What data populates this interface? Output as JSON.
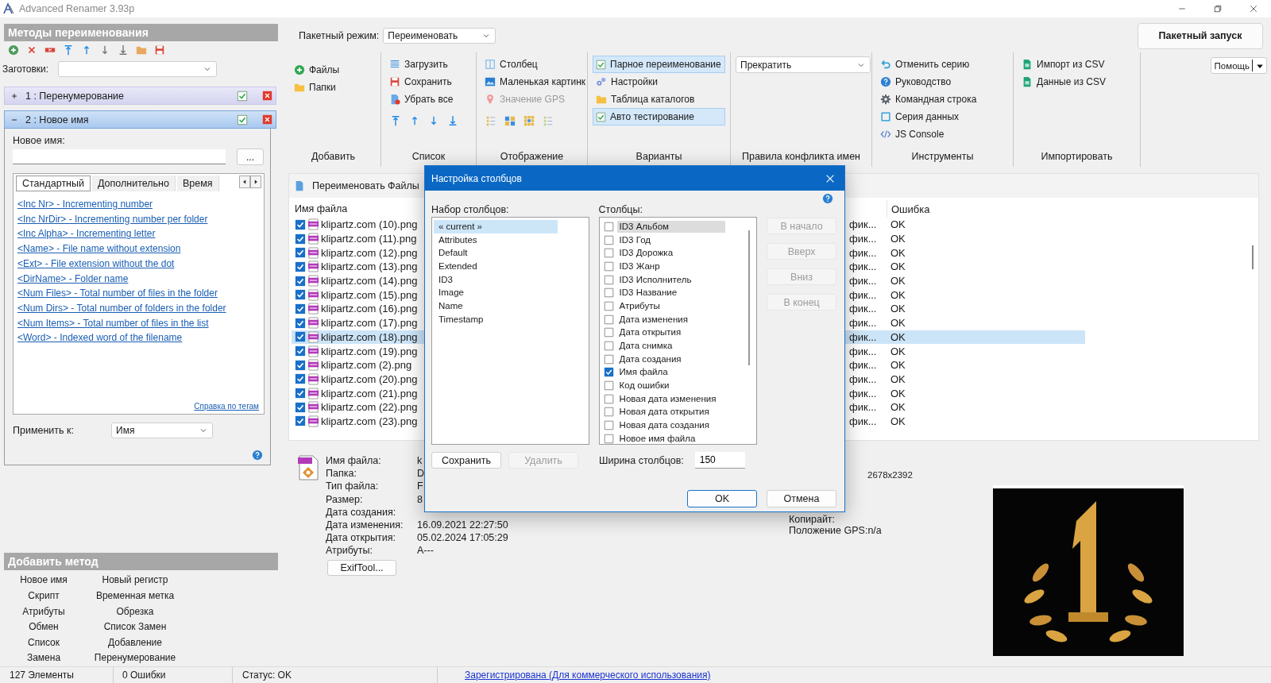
{
  "window": {
    "title": "Advanced Renamer 3.93p"
  },
  "methods_panel": {
    "title": "Методы переименования",
    "presets_label": "Заготовки:",
    "methods": [
      {
        "label": "1 : Перенумерование",
        "expanded": false,
        "enabled": true
      },
      {
        "label": "2 : Новое имя",
        "expanded": true,
        "enabled": true
      }
    ],
    "new_name_label": "Новое имя:",
    "browse_button": "...",
    "tabs": [
      {
        "label": "Стандартный",
        "selected": true
      },
      {
        "label": "Дополнительно",
        "selected": false
      },
      {
        "label": "Время",
        "selected": false
      }
    ],
    "tags": [
      "<Inc Nr> - Incrementing number",
      "<Inc NrDir> - Incrementing number per folder",
      "<Inc Alpha> - Incrementing letter",
      "<Name> - File name without extension",
      "<Ext> - File extension without the dot",
      "<DirName> - Folder name",
      "<Num Files> - Total number of files in the folder",
      "<Num Dirs> - Total number of folders in the folder",
      "<Num Items> - Total number of files in the list",
      "<Word> - Indexed word of the filename"
    ],
    "tag_help_link": "Справка по тегам",
    "apply_to_label": "Применить к:",
    "apply_to_value": "Имя"
  },
  "add_method": {
    "title": "Добавить метод",
    "items": [
      "Новое имя",
      "Новый регистр",
      "Скрипт",
      "Временная метка",
      "Атрибуты",
      "Обрезка",
      "Обмен",
      "Список Замен",
      "Список",
      "Добавление",
      "Замена",
      "Перенумерование"
    ]
  },
  "batch_mode": {
    "label": "Пакетный режим:",
    "value": "Переименовать"
  },
  "batch_start_button": "Пакетный запуск",
  "ribbon": {
    "groups": [
      {
        "title": "Добавить",
        "items": [
          {
            "kind": "command",
            "label": "Файлы"
          },
          {
            "kind": "command",
            "label": "Папки"
          }
        ]
      },
      {
        "title": "Список",
        "items": [
          {
            "kind": "command",
            "label": "Загрузить"
          },
          {
            "kind": "command",
            "label": "Сохранить"
          },
          {
            "kind": "command",
            "label": "Убрать все"
          }
        ]
      },
      {
        "title": "Отображение",
        "items": [
          {
            "kind": "command",
            "label": "Столбец",
            "disabled": false
          },
          {
            "kind": "command",
            "label": "Маленькая картинк",
            "disabled": false
          },
          {
            "kind": "command",
            "label": "Значение GPS",
            "disabled": true
          }
        ]
      },
      {
        "title": "Варианты",
        "items": [
          {
            "kind": "toggle",
            "label": "Парное переименование",
            "checked": true
          },
          {
            "kind": "command",
            "label": "Настройки"
          },
          {
            "kind": "command",
            "label": "Таблица каталогов"
          },
          {
            "kind": "toggle",
            "label": "Авто тестирование",
            "checked": true
          }
        ]
      },
      {
        "title": "Правила конфликта имен",
        "items": [
          {
            "kind": "dropdown",
            "label": "Прекратить"
          }
        ]
      },
      {
        "title": "Инструменты",
        "items": [
          {
            "kind": "command",
            "label": "Отменить серию"
          },
          {
            "kind": "command",
            "label": "Руководство"
          },
          {
            "kind": "command",
            "label": "Командная строка"
          },
          {
            "kind": "command",
            "label": "Серия данных"
          },
          {
            "kind": "command",
            "label": "JS Console"
          }
        ]
      },
      {
        "title": "Импортировать",
        "items": [
          {
            "kind": "command",
            "label": "Импорт из CSV"
          },
          {
            "kind": "command",
            "label": "Данные из CSV"
          }
        ]
      }
    ]
  },
  "help_button": "Помощь",
  "file_panel": {
    "title": "Переименовать Файлы",
    "columns": [
      "Имя файла",
      "Ошибка"
    ],
    "rows": [
      {
        "name": "klipartz.com (10).png",
        "column_2": "фик...",
        "error": "OK",
        "checked": true,
        "selected": false
      },
      {
        "name": "klipartz.com (11).png",
        "column_2": "фик...",
        "error": "OK",
        "checked": true,
        "selected": false
      },
      {
        "name": "klipartz.com (12).png",
        "column_2": "фик...",
        "error": "OK",
        "checked": true,
        "selected": false
      },
      {
        "name": "klipartz.com (13).png",
        "column_2": "фик...",
        "error": "OK",
        "checked": true,
        "selected": false
      },
      {
        "name": "klipartz.com (14).png",
        "column_2": "фик...",
        "error": "OK",
        "checked": true,
        "selected": false
      },
      {
        "name": "klipartz.com (15).png",
        "column_2": "фик...",
        "error": "OK",
        "checked": true,
        "selected": false
      },
      {
        "name": "klipartz.com (16).png",
        "column_2": "фик...",
        "error": "OK",
        "checked": true,
        "selected": false
      },
      {
        "name": "klipartz.com (17).png",
        "column_2": "фик...",
        "error": "OK",
        "checked": true,
        "selected": false
      },
      {
        "name": "klipartz.com (18).png",
        "column_2": "фик...",
        "error": "OK",
        "checked": true,
        "selected": true
      },
      {
        "name": "klipartz.com (19).png",
        "column_2": "фик...",
        "error": "OK",
        "checked": true,
        "selected": false
      },
      {
        "name": "klipartz.com (2).png",
        "column_2": "фик...",
        "error": "OK",
        "checked": true,
        "selected": false
      },
      {
        "name": "klipartz.com (20).png",
        "column_2": "фик...",
        "error": "OK",
        "checked": true,
        "selected": false
      },
      {
        "name": "klipartz.com (21).png",
        "column_2": "фик...",
        "error": "OK",
        "checked": true,
        "selected": false
      },
      {
        "name": "klipartz.com (22).png",
        "column_2": "фик...",
        "error": "OK",
        "checked": true,
        "selected": false
      },
      {
        "name": "klipartz.com (23).png",
        "column_2": "фик...",
        "error": "OK",
        "checked": true,
        "selected": false
      }
    ]
  },
  "file_info": {
    "fields": [
      {
        "label": "Имя файла:",
        "value": "k"
      },
      {
        "label": "Папка:",
        "value": "D"
      },
      {
        "label": "Тип файла:",
        "value": "F"
      },
      {
        "label": "Размер:",
        "value": "8"
      },
      {
        "label": "Дата создания:"
      },
      {
        "label": "Дата изменения:",
        "value": "16.09.2021 22:27:50"
      },
      {
        "label": "Дата открытия:",
        "value": "05.02.2024 17:05:29"
      },
      {
        "label": "Атрибуты:",
        "value": "A---"
      }
    ],
    "exif_button": "ExifTool...",
    "dimensions": "2678x2392",
    "copyright_label": "Копирайт:",
    "gps": "Положение GPS:n/a"
  },
  "dialog": {
    "title": "Настройка столбцов",
    "sets_label": "Набор столбцов:",
    "sets": [
      {
        "label": "« current »",
        "selected": true
      },
      {
        "label": "Attributes",
        "selected": false
      },
      {
        "label": "Default",
        "selected": false
      },
      {
        "label": "Extended",
        "selected": false
      },
      {
        "label": "ID3",
        "selected": false
      },
      {
        "label": "Image",
        "selected": false
      },
      {
        "label": "Name",
        "selected": false
      },
      {
        "label": "Timestamp",
        "selected": false
      }
    ],
    "columns_label": "Столбцы:",
    "columns": [
      {
        "label": "ID3 Альбом",
        "checked": false,
        "selected": true
      },
      {
        "label": "ID3 Год",
        "checked": false,
        "selected": false
      },
      {
        "label": "ID3 Дорожка",
        "checked": false,
        "selected": false
      },
      {
        "label": "ID3 Жанр",
        "checked": false,
        "selected": false
      },
      {
        "label": "ID3 Исполнитель",
        "checked": false,
        "selected": false
      },
      {
        "label": "ID3 Название",
        "checked": false,
        "selected": false
      },
      {
        "label": "Атрибуты",
        "checked": false,
        "selected": false
      },
      {
        "label": "Дата изменения",
        "checked": false,
        "selected": false
      },
      {
        "label": "Дата открытия",
        "checked": false,
        "selected": false
      },
      {
        "label": "Дата снимка",
        "checked": false,
        "selected": false
      },
      {
        "label": "Дата создания",
        "checked": false,
        "selected": false
      },
      {
        "label": "Имя файла",
        "checked": true,
        "selected": false
      },
      {
        "label": "Код ошибки",
        "checked": false,
        "selected": false
      },
      {
        "label": "Новая дата изменения",
        "checked": false,
        "selected": false
      },
      {
        "label": "Новая дата открытия",
        "checked": false,
        "selected": false
      },
      {
        "label": "Новая дата создания",
        "checked": false,
        "selected": false
      },
      {
        "label": "Новое имя файла",
        "checked": false,
        "selected": false
      }
    ],
    "move_buttons": [
      {
        "label": "В начало",
        "disabled": true
      },
      {
        "label": "Вверх",
        "disabled": true
      },
      {
        "label": "Вниз",
        "disabled": true
      },
      {
        "label": "В конец",
        "disabled": true
      }
    ],
    "save_button": {
      "label": "Сохранить",
      "disabled": false
    },
    "delete_button": {
      "label": "Удалить",
      "disabled": true
    },
    "width_label": "Ширина столбцов:",
    "width_value": "150",
    "ok_button": "OK",
    "cancel_button": "Отмена"
  },
  "status_bar": {
    "items": [
      "127 Элементы",
      "0 Ошибки",
      "Статус: OK"
    ],
    "link": "Зарегистрирована  (Для коммерческого использования)"
  }
}
